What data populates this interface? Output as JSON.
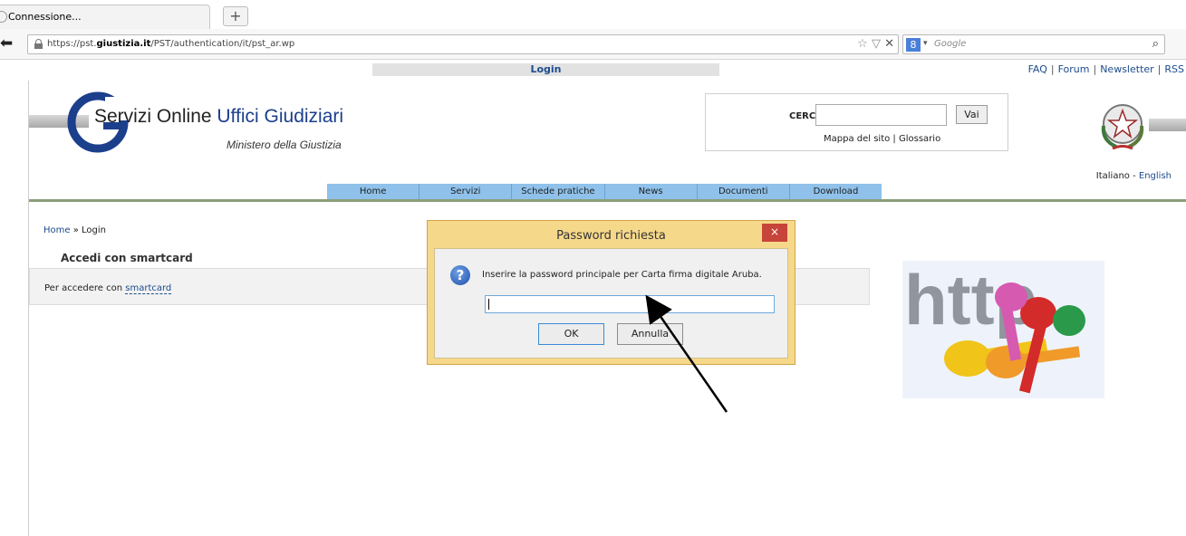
{
  "browser": {
    "tab_title": "Connessione...",
    "newtab_label": "+",
    "url_prefix": "https://pst.",
    "url_domain": "giustizia.it",
    "url_path": "/PST/authentication/it/pst_ar.wp",
    "search_engine_letter": "8",
    "search_placeholder": "Google"
  },
  "page": {
    "login_bar": "Login",
    "top_links": [
      "FAQ",
      "Forum",
      "Newsletter",
      "RSS"
    ],
    "logo": {
      "title_part1": "Servizi Online ",
      "title_part2": "Uffici Giudiziari",
      "subtitle": "Ministero della Giustizia"
    },
    "search": {
      "label": "CERCA",
      "button": "Vai",
      "link_sitemap": "Mappa del sito",
      "link_glossary": "Glossario"
    },
    "languages": {
      "it": "Italiano",
      "en": "English"
    },
    "menu": [
      "Home",
      "Servizi",
      "Schede pratiche",
      "News",
      "Documenti",
      "Download"
    ],
    "breadcrumb": {
      "home": "Home",
      "separator": "»",
      "current": "Login"
    },
    "section": {
      "title": "Accedi con smartcard",
      "text": "Per accedere con ",
      "link": "smartcard"
    }
  },
  "dialog": {
    "title": "Password richiesta",
    "message": "Inserire la password principale per Carta firma digitale Aruba.",
    "password_value": "",
    "ok_label": "OK",
    "cancel_label": "Annulla",
    "close_label": "×"
  },
  "colors": {
    "menu_bg": "#8fc1ea",
    "dialog_frame": "#f6d88b",
    "link_blue": "#1c4c8c",
    "close_red": "#c7443a"
  }
}
